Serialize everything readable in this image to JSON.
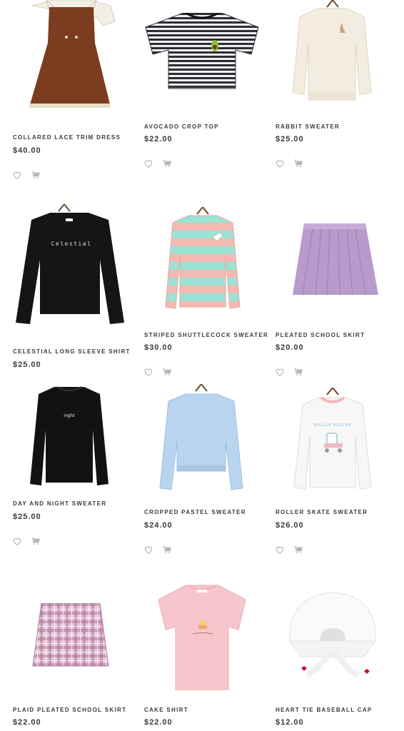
{
  "products": [
    {
      "name": "COLLARED LACE TRIM DRESS",
      "price": "$40.00"
    },
    {
      "name": "AVOCADO CROP TOP",
      "price": "$22.00"
    },
    {
      "name": "RABBIT SWEATER",
      "price": "$25.00"
    },
    {
      "name": "CELESTIAL LONG SLEEVE SHIRT",
      "price": "$25.00",
      "print": "Celestial"
    },
    {
      "name": "STRIPED SHUTTLECOCK SWEATER",
      "price": "$30.00"
    },
    {
      "name": "PLEATED SCHOOL SKIRT",
      "price": "$20.00"
    },
    {
      "name": "DAY AND NIGHT SWEATER",
      "price": "$25.00",
      "print": "night"
    },
    {
      "name": "CROPPED PASTEL SWEATER",
      "price": "$24.00"
    },
    {
      "name": "ROLLER SKATE SWEATER",
      "price": "$26.00",
      "print": "ROLLIN ROLLER"
    },
    {
      "name": "PLAID PLEATED SCHOOL SKIRT",
      "price": "$22.00"
    },
    {
      "name": "CAKE SHIRT",
      "price": "$22.00"
    },
    {
      "name": "HEART TIE BASEBALL CAP",
      "price": "$12.00"
    }
  ],
  "icons": {
    "wishlist": "heart-icon",
    "cart": "cart-icon"
  },
  "colors": {
    "text": "#3a3a3a",
    "icon": "#b5b5b5"
  }
}
